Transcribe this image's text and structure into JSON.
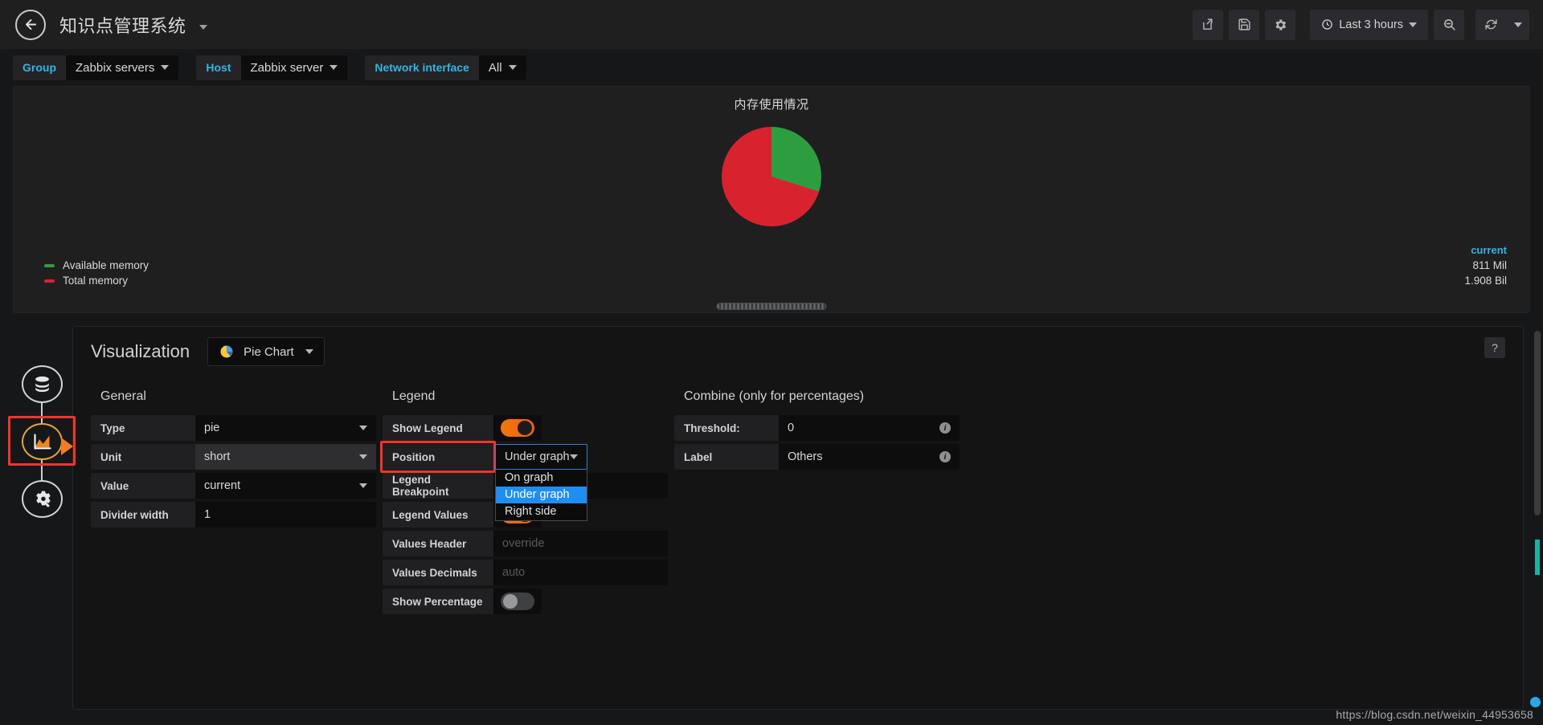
{
  "navbar": {
    "back_icon": "arrow-left-icon",
    "title": "知识点管理系统",
    "actions": [
      {
        "name": "share-dashboard-button",
        "icon": "share-icon"
      },
      {
        "name": "save-dashboard-button",
        "icon": "save-icon"
      },
      {
        "name": "dashboard-settings-button",
        "icon": "gear-icon"
      }
    ],
    "time_picker": {
      "icon": "clock-icon",
      "label": "Last 3 hours"
    },
    "zoom_out": {
      "name": "zoom-out-button",
      "icon": "magnifier-minus-icon"
    },
    "refresh": {
      "name": "refresh-button",
      "icon": "refresh-icon"
    }
  },
  "variables": [
    {
      "label": "Group",
      "value": "Zabbix servers"
    },
    {
      "label": "Host",
      "value": "Zabbix server"
    },
    {
      "label": "Network interface",
      "value": "All"
    }
  ],
  "graph_panel": {
    "title": "内存使用情况",
    "values_header": "current"
  },
  "chart_data": {
    "type": "pie",
    "title": "内存使用情况",
    "labels": [
      "Available memory",
      "Total memory"
    ],
    "values": [
      811,
      1908
    ],
    "display_values": [
      "811 Mil",
      "1.908 Bil"
    ],
    "colors": [
      "#2d9e3f",
      "#d8232f"
    ],
    "percentages": [
      29.8,
      70.2
    ],
    "legend": {
      "position": "Under graph",
      "show": true,
      "header": "current"
    },
    "unit": "short"
  },
  "edit_sidebar": {
    "items": [
      {
        "name": "queries-tab",
        "icon": "database-icon",
        "active": false
      },
      {
        "name": "visualization-tab",
        "icon": "area-chart-icon",
        "active": true
      },
      {
        "name": "general-settings-tab",
        "icon": "gear-wrench-icon",
        "active": false
      }
    ]
  },
  "editor": {
    "heading": "Visualization",
    "viz_type": {
      "label": "Pie Chart",
      "icon": "pie-chart-icon"
    },
    "help_label": "?",
    "general": {
      "title": "General",
      "rows": [
        {
          "label": "Type",
          "value": "pie",
          "kind": "select"
        },
        {
          "label": "Unit",
          "value": "short",
          "kind": "select",
          "hover": true
        },
        {
          "label": "Value",
          "value": "current",
          "kind": "select"
        },
        {
          "label": "Divider width",
          "value": "1",
          "kind": "text"
        }
      ]
    },
    "legend": {
      "title": "Legend",
      "show_legend": {
        "label": "Show Legend",
        "state": "on"
      },
      "position": {
        "label": "Position",
        "value": "Under graph",
        "options": [
          "On graph",
          "Under graph",
          "Right side"
        ],
        "selected": "Under graph",
        "open": true,
        "highlighted": true
      },
      "breakpoint": {
        "label": "Legend Breakpoint",
        "value": ""
      },
      "legend_values": {
        "label": "Legend Values",
        "state": "on"
      },
      "values_header": {
        "label": "Values Header",
        "placeholder": "override",
        "value": ""
      },
      "values_decimals": {
        "label": "Values Decimals",
        "placeholder": "auto",
        "value": ""
      },
      "show_percentage": {
        "label": "Show Percentage",
        "state": "off"
      }
    },
    "combine": {
      "title": "Combine (only for percentages)",
      "rows": [
        {
          "label": "Threshold:",
          "value": "0",
          "info": "i"
        },
        {
          "label": "Label",
          "value": "Others",
          "info": "i"
        }
      ]
    }
  },
  "watermark": "https://blog.csdn.net/weixin_44953658",
  "colors": {
    "accent_blue": "#33b5e5",
    "highlight_red": "#f5342a",
    "toggle_on": "#f2770a",
    "dropdown_selected": "#1f8ef3",
    "pie_green": "#2d9e3f",
    "pie_red": "#d8232f"
  }
}
